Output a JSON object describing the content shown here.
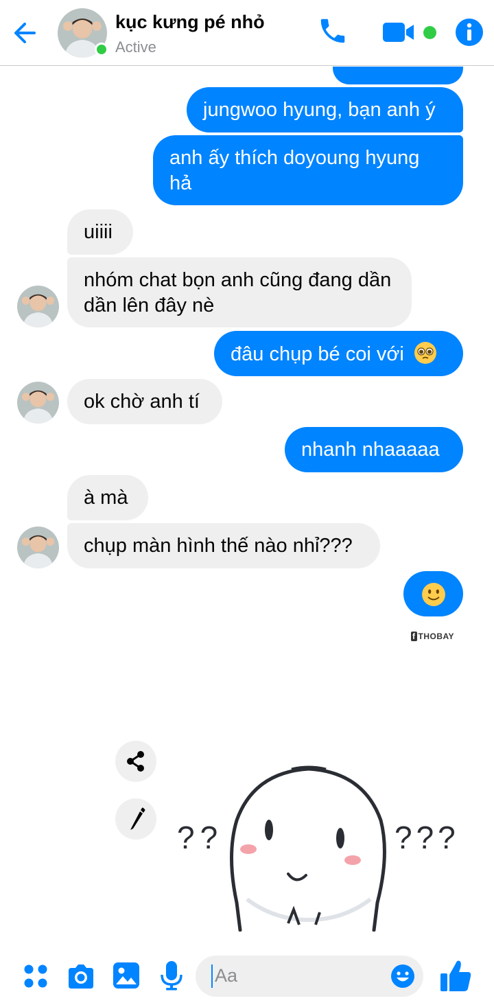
{
  "header": {
    "contact_name": "kục kưng pé nhỏ",
    "status": "Active",
    "icons": [
      "back-arrow-icon",
      "phone-icon",
      "video-camera-icon",
      "info-icon"
    ],
    "accent_color": "#0084ff",
    "active_color": "#31cc46"
  },
  "messages": [
    {
      "side": "out",
      "text": "jungwoo hyung, bạn anh ý"
    },
    {
      "side": "out",
      "text": "anh ấy thích doyoung hyung hả"
    },
    {
      "side": "in",
      "text": "uiiii"
    },
    {
      "side": "in",
      "text": "nhóm chat bọn anh cũng đang dần dần lên đây nè"
    },
    {
      "side": "out",
      "text": "đâu chụp bé coi với",
      "emoji": "pleading-face"
    },
    {
      "side": "in",
      "text": "ok chờ anh tí"
    },
    {
      "side": "out",
      "text": "nhanh nhaaaaa"
    },
    {
      "side": "in",
      "text": "à mà"
    },
    {
      "side": "in",
      "text": "chụp màn hình thế nào nhỉ???"
    },
    {
      "side": "out",
      "emoji": "slightly-smiling-face"
    }
  ],
  "watermark": "THOBAY",
  "sticker": {
    "left_marks": "??",
    "right_marks": "???"
  },
  "composer": {
    "placeholder": "Aa",
    "icons": [
      "apps-icon",
      "camera-icon",
      "image-icon",
      "microphone-icon",
      "emoji-icon",
      "like-icon"
    ]
  }
}
